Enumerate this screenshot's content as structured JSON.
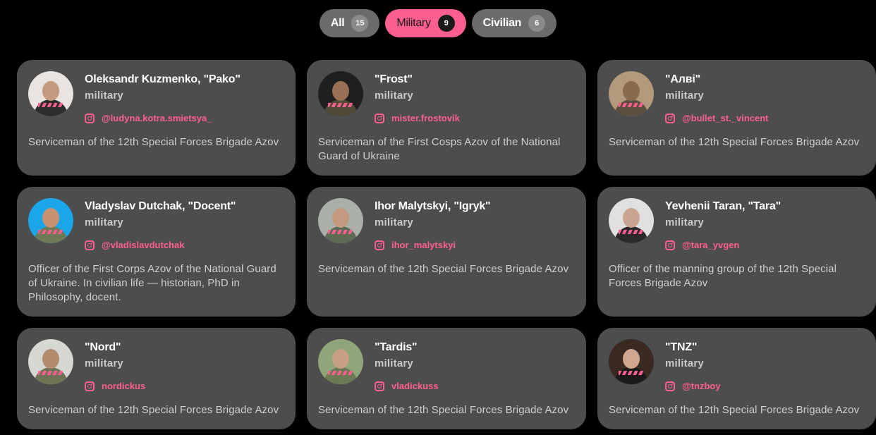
{
  "tabs": [
    {
      "label": "All",
      "count": "15",
      "active": false
    },
    {
      "label": "Military",
      "count": "9",
      "active": true
    },
    {
      "label": "Civilian",
      "count": "6",
      "active": false
    }
  ],
  "colors": {
    "accent": "#ff5f8f",
    "card_bg": "#4d4d4d",
    "page_bg": "#000000"
  },
  "cards": [
    {
      "name": "Oleksandr Kuzmenko, \"Pako\"",
      "role": "military",
      "instagram": "@ludyna.kotra.smietsya_",
      "description": "Serviceman of the 12th Special Forces Brigade Azov",
      "avatar": {
        "bg": "#e9e4df",
        "skin": "#c49a7e",
        "shirt": "#2c2c2c"
      }
    },
    {
      "name": "\"Frost\"",
      "role": "military",
      "instagram": "mister.frostovik",
      "description": "Serviceman of the First Cosps Azov of the National Guard of Ukraine",
      "avatar": {
        "bg": "#1f1f1f",
        "skin": "#9a7055",
        "shirt": "#514a37"
      }
    },
    {
      "name": "\"Алві\"",
      "role": "military",
      "instagram": "@bullet_st._vincent",
      "description": "Serviceman of the 12th Special Forces Brigade Azov",
      "avatar": {
        "bg": "#b49a7c",
        "skin": "#8a6a4f",
        "shirt": "#5b5040"
      }
    },
    {
      "name": "Vladyslav Dutchak, \"Docent\"",
      "role": "military",
      "instagram": "@vladislavdutchak",
      "description": "Officer of the First Corps Azov of the National Guard of Ukraine. In civilian life — historian, PhD in Philosophy, docent.",
      "avatar": {
        "bg": "#1aa6e8",
        "skin": "#c7906f",
        "shirt": "#6e7a55"
      }
    },
    {
      "name": "Ihor Malytskyi, \"Igryk\"",
      "role": "military",
      "instagram": "ihor_malytskyi",
      "description": "Serviceman of the 12th Special Forces Brigade Azov",
      "avatar": {
        "bg": "#a9b0a7",
        "skin": "#c39a80",
        "shirt": "#5e6b54"
      }
    },
    {
      "name": "Yevhenii Taran, \"Tara\"",
      "role": "military",
      "instagram": "@tara_yvgen",
      "description": "Officer of the manning group of the 12th Special Forces Brigade Azov",
      "avatar": {
        "bg": "#e0e0e0",
        "skin": "#caa490",
        "shirt": "#2a2a2a"
      }
    },
    {
      "name": "\"Nord\"",
      "role": "military",
      "instagram": "nordickus",
      "description": "Serviceman of the 12th Special Forces Brigade Azov",
      "avatar": {
        "bg": "#d7d7d2",
        "skin": "#b28a6c",
        "shirt": "#6f7456"
      }
    },
    {
      "name": "\"Tardis\"",
      "role": "military",
      "instagram": "vladickuss",
      "description": "Serviceman of the 12th Special Forces Brigade Azov",
      "avatar": {
        "bg": "#8fa57a",
        "skin": "#c79f84",
        "shirt": "#6b7a52"
      }
    },
    {
      "name": "\"TNZ\"",
      "role": "military",
      "instagram": "@tnzboy",
      "description": "Serviceman of the 12th Special Forces Brigade Azov",
      "avatar": {
        "bg": "#3a2a22",
        "skin": "#d0a88f",
        "shirt": "#1a1a1a"
      }
    }
  ]
}
